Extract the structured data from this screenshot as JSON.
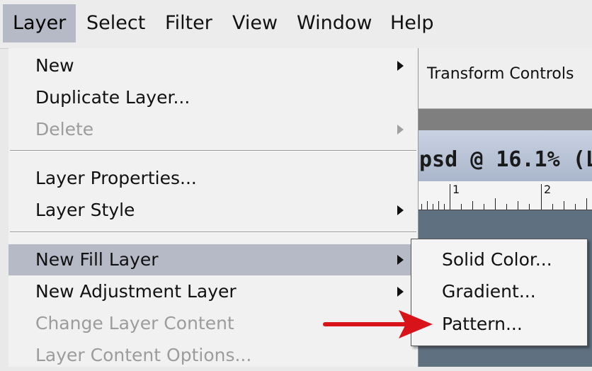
{
  "menubar": {
    "items": [
      {
        "label": "Layer"
      },
      {
        "label": "Select"
      },
      {
        "label": "Filter"
      },
      {
        "label": "View"
      },
      {
        "label": "Window"
      },
      {
        "label": "Help"
      }
    ]
  },
  "options_bar": {
    "label": "Transform Controls"
  },
  "document": {
    "title": "psd @ 16.1% (L"
  },
  "ruler": {
    "labels": [
      "1",
      "2"
    ]
  },
  "layer_menu": {
    "items": [
      {
        "label": "New",
        "enabled": true,
        "submenu": true
      },
      {
        "label": "Duplicate Layer...",
        "enabled": true,
        "submenu": false
      },
      {
        "label": "Delete",
        "enabled": false,
        "submenu": true
      },
      {
        "label": "Layer Properties...",
        "enabled": true,
        "submenu": false
      },
      {
        "label": "Layer Style",
        "enabled": true,
        "submenu": true
      },
      {
        "label": "New Fill Layer",
        "enabled": true,
        "submenu": true,
        "highlighted": true
      },
      {
        "label": "New Adjustment Layer",
        "enabled": true,
        "submenu": true
      },
      {
        "label": "Change Layer Content",
        "enabled": false,
        "submenu": false
      },
      {
        "label": "Layer Content Options...",
        "enabled": false,
        "submenu": false
      }
    ]
  },
  "fill_submenu": {
    "items": [
      {
        "label": "Solid Color..."
      },
      {
        "label": "Gradient..."
      },
      {
        "label": "Pattern..."
      }
    ]
  },
  "annotation": {
    "icon": "red-arrow-icon",
    "color": "#d8141a",
    "target": "Pattern..."
  },
  "colors": {
    "highlight": "#b6b9c6",
    "disabled_text": "#9c9c9c"
  }
}
